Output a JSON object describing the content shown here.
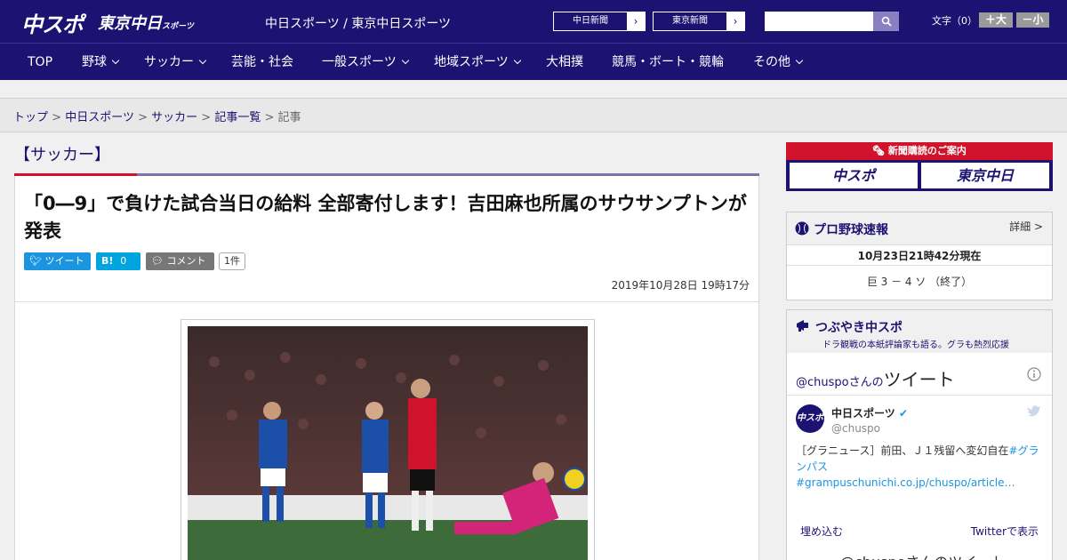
{
  "header": {
    "logo_chuspo": "中スポ",
    "logo_tokyo": "東京中日",
    "logo_tokyo_small": "スポーツ",
    "site_name": "中日スポーツ / 東京中日スポーツ",
    "ext_links": [
      "中日新聞",
      "東京新聞"
    ],
    "search_placeholder": "",
    "font_label": "文字（0）",
    "font_larger": "＋大",
    "font_smaller": "－小"
  },
  "nav": [
    {
      "label": "TOP",
      "chev": false
    },
    {
      "label": "野球",
      "chev": true
    },
    {
      "label": "サッカー",
      "chev": true
    },
    {
      "label": "芸能・社会",
      "chev": false
    },
    {
      "label": "一般スポーツ",
      "chev": true
    },
    {
      "label": "地域スポーツ",
      "chev": true
    },
    {
      "label": "大相撲",
      "chev": false
    },
    {
      "label": "競馬・ボート・競輪",
      "chev": false
    },
    {
      "label": "その他",
      "chev": true
    }
  ],
  "breadcrumb": {
    "items": [
      "トップ",
      "中日スポーツ",
      "サッカー",
      "記事一覧"
    ],
    "current": "記事",
    "sep": ">"
  },
  "category": "【サッカー】",
  "article": {
    "headline": "「0―9」で負けた試合当日の給料 全部寄付します！吉田麻也所属のサウサンプトンが発表",
    "tweet_label": "ツイート",
    "hatena_label": "B!",
    "hatena_count": "0",
    "comment_label": "コメント",
    "comment_count": "1件",
    "date": "2019年10月28日 19時17分"
  },
  "sidebar": {
    "ad_top": "新聞購読のご案内",
    "ad_logo_1": "中スポ",
    "ad_logo_2": "東京中日",
    "baseball": {
      "title": "プロ野球速報",
      "detail": "詳細 >",
      "time": "10月23日21時42分現在",
      "score": "巨 3 － 4 ソ （終了）"
    },
    "tweets": {
      "title": "つぶやき中スポ",
      "subtitle": "ドラ観戦の本紙評論家も語る。グラも熱烈応援",
      "handle_prefix": "@chuspo",
      "handle_suffix": "さんの",
      "header_big": "ツイート",
      "account_name": "中日スポーツ",
      "account_handle": "@chuspo",
      "avatar_text": "中スポ",
      "tweet_text": "［グラニュース］前田、Ｊ１残留へ変幻自在",
      "tweet_tag": "#グランパス #grampuschunichi.co.jp/chuspo/article…",
      "embed": "埋め込む",
      "view_on_twitter": "Twitterで表示",
      "bottom": "@chuspoさんのツイート"
    }
  },
  "colors": {
    "brand_navy": "#1c1272",
    "accent_red": "#d0122a",
    "twitter_blue": "#1b95e0",
    "hatena_blue": "#00a4de",
    "comment_grey": "#777777"
  }
}
